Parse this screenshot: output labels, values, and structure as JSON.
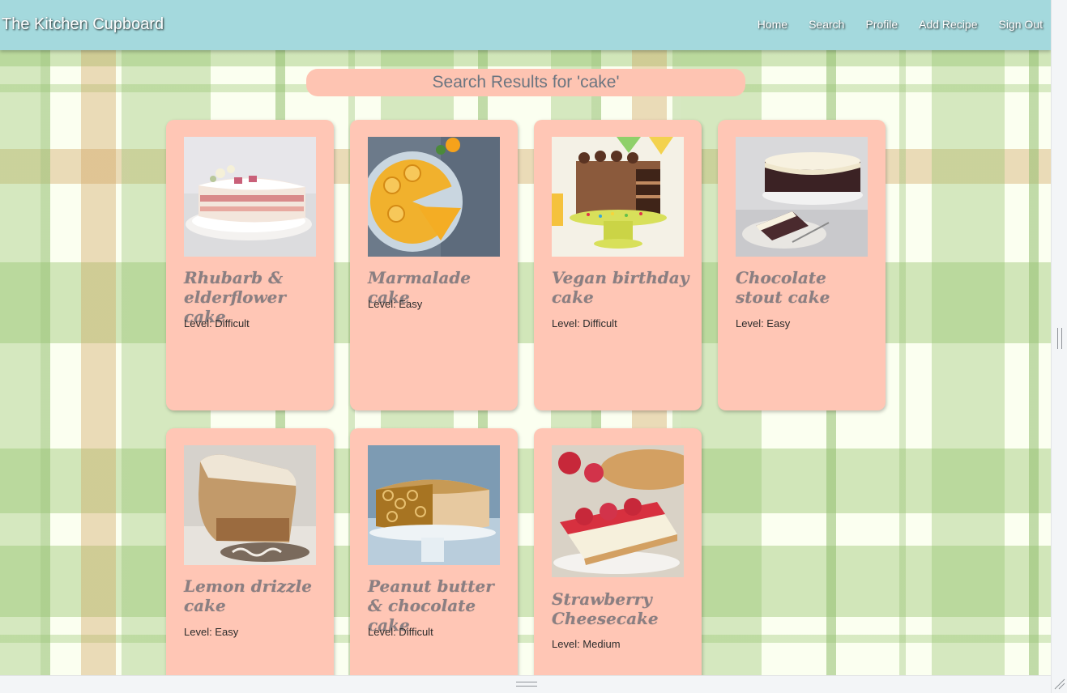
{
  "navbar": {
    "brand": "The Kitchen Cupboard",
    "links": [
      "Home",
      "Search",
      "Profile",
      "Add Recipe",
      "Sign Out"
    ],
    "background": "#a4d9dd"
  },
  "search": {
    "heading": "Search Results for 'cake'"
  },
  "cards": [
    {
      "title": "Rhubarb & elderflower cake",
      "level": "Level: Difficult",
      "image": "layered-cream-cake-photo"
    },
    {
      "title": "Marmalade cake",
      "level": "Level: Easy",
      "image": "orange-upside-down-cake-photo"
    },
    {
      "title": "Vegan birthday cake",
      "level": "Level: Difficult",
      "image": "chocolate-sprinkle-cake-photo"
    },
    {
      "title": "Chocolate stout cake",
      "level": "Level: Easy",
      "image": "chocolate-cake-cream-frosting-photo"
    },
    {
      "title": "Lemon drizzle cake",
      "level": "Level: Easy",
      "image": "lemon-loaf-cake-photo"
    },
    {
      "title": "Peanut butter & chocolate cake",
      "level": "Level: Difficult",
      "image": "peanut-butter-cake-photo"
    },
    {
      "title": "Strawberry Cheesecake",
      "level": "Level: Medium",
      "image": "strawberry-cheesecake-photo"
    }
  ],
  "colors": {
    "card": "#ffc6b5",
    "heading_text": "#6b7580",
    "title_text": "#8a7f82"
  }
}
